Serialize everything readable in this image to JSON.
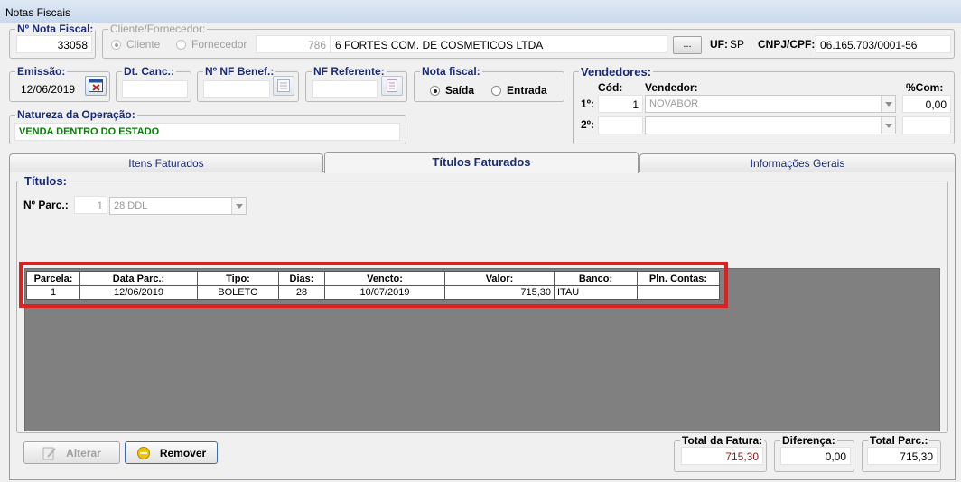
{
  "window": {
    "title": "Notas Fiscais"
  },
  "nota": {
    "label": "Nº Nota Fiscal:",
    "value": "33058"
  },
  "cliente": {
    "label": "Cliente/Fornecedor:",
    "opt_cliente": "Cliente",
    "opt_fornecedor": "Fornecedor",
    "selected": "Cliente",
    "code": "786",
    "name": "6 FORTES COM. DE COSMETICOS LTDA",
    "lookup_label": "...",
    "uf_label": "UF:",
    "uf_value": "SP",
    "cnpj_label": "CNPJ/CPF:",
    "cnpj_value": "06.165.703/0001-56"
  },
  "emissao": {
    "label": "Emissão:",
    "value": "12/06/2019"
  },
  "dt_canc": {
    "label": "Dt. Canc.:",
    "value": ""
  },
  "nf_benef": {
    "label": "Nº NF Benef.:",
    "value": ""
  },
  "nf_ref": {
    "label": "NF Referente:",
    "value": ""
  },
  "nota_fiscal_tipo": {
    "label": "Nota fiscal:",
    "opt_saida": "Saída",
    "opt_entrada": "Entrada",
    "selected": "Saída"
  },
  "natureza": {
    "label": "Natureza da Operação:",
    "value": "VENDA DENTRO DO ESTADO"
  },
  "vendedores": {
    "label": "Vendedores:",
    "cod_header": "Cód:",
    "vendedor_header": "Vendedor:",
    "com_header": "%Com:",
    "row1": {
      "label": "1º:",
      "cod": "1",
      "vendedor": "NOVABOR",
      "com": "0,00"
    },
    "row2": {
      "label": "2º:",
      "cod": "",
      "vendedor": "",
      "com": ""
    }
  },
  "tabs": [
    {
      "label": "Itens Faturados",
      "active": false
    },
    {
      "label": "Títulos Faturados",
      "active": true
    },
    {
      "label": "Informações Gerais",
      "active": false
    }
  ],
  "titulos": {
    "label": "Títulos:",
    "parc_label": "Nº Parc.:",
    "parc_value": "1",
    "parc_combo": "28 DDL",
    "columns": [
      "Parcela:",
      "Data Parc.:",
      "Tipo:",
      "Dias:",
      "Vencto:",
      "Valor:",
      "Banco:",
      "Pln. Contas:"
    ],
    "rows": [
      [
        "1",
        "12/06/2019",
        "BOLETO",
        "28",
        "10/07/2019",
        "715,30",
        "ITAU",
        ""
      ]
    ]
  },
  "buttons": {
    "alterar": "Alterar",
    "remover": "Remover"
  },
  "totais": {
    "fatura_label": "Total da Fatura:",
    "fatura_value": "715,30",
    "diferenca_label": "Diferença:",
    "diferenca_value": "0,00",
    "parc_label": "Total Parc.:",
    "parc_value": "715,30"
  },
  "colors": {
    "accent_label": "#1a2a78",
    "natureza_text": "#0a7a0a",
    "highlight": "#e02020",
    "total_fatura": "#8a1a1a"
  }
}
